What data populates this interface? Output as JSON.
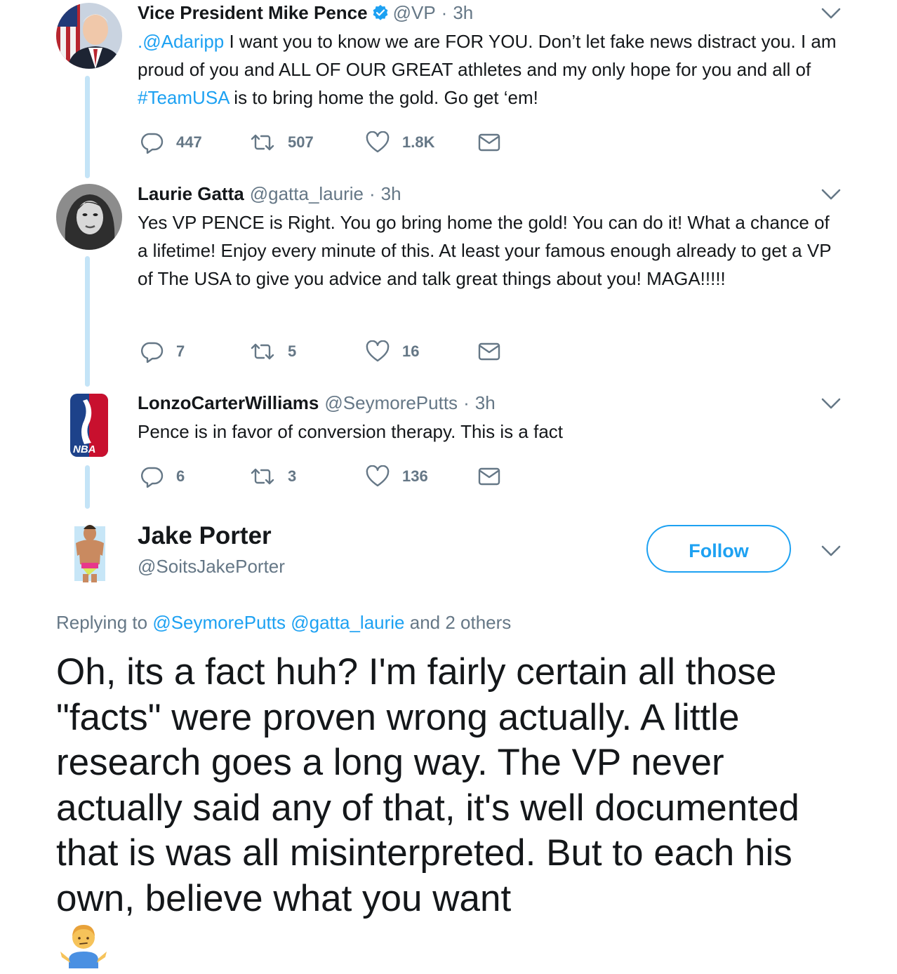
{
  "tweets": [
    {
      "name": "Vice President Mike Pence",
      "verified": true,
      "handle": "@VP",
      "separator": "·",
      "time": "3h",
      "text_mention": ".@Adaripp",
      "text_part1": " I want you to know we are FOR YOU. Don’t let fake news distract you. I am proud of you and ALL OF OUR GREAT athletes and my only hope for you and all of ",
      "text_hashtag": "#TeamUSA",
      "text_part2": " is to bring home the gold. Go get ‘em!",
      "replies": "447",
      "retweets": "507",
      "likes": "1.8K"
    },
    {
      "name": "Laurie Gatta",
      "handle": "@gatta_laurie",
      "separator": "·",
      "time": "3h",
      "text": "Yes VP PENCE is Right. You go bring home the gold! You can do it! What a chance of a lifetime! Enjoy every minute of this. At least your famous enough already to get a VP of The USA to give you advice and talk great things about you! MAGA!!!!!",
      "replies": "7",
      "retweets": "5",
      "likes": "16"
    },
    {
      "name": "LonzoCarterWilliams",
      "handle": "@SeymorePutts",
      "separator": "·",
      "time": "3h",
      "text": "Pence is in favor of conversion therapy. This is a fact",
      "replies": "6",
      "retweets": "3",
      "likes": "136",
      "avatar_logo_text": "NBA"
    }
  ],
  "main_tweet": {
    "name": "Jake Porter",
    "handle": "@SoitsJakePorter",
    "follow_label": "Follow",
    "replying_prefix": "Replying to ",
    "replying_user1": "@SeymorePutts",
    "replying_user2": "@gatta_laurie",
    "replying_suffix": " and 2 others",
    "text": "Oh, its a fact huh? I'm fairly certain all those \"facts\" were proven wrong actually. A little research goes a long way. The VP never actually said any of that, it's well documented that is was all misinterpreted. But to each his own, believe what you want",
    "emoji_name": "man-shrugging"
  },
  "colors": {
    "link": "#1da1f2",
    "secondary_text": "#657786",
    "thread_line": "#c4e4f7",
    "primary_text": "#14171a"
  },
  "icons": [
    "reply-icon",
    "retweet-icon",
    "like-icon",
    "direct-message-icon",
    "chevron-down-icon",
    "verified-badge-icon"
  ]
}
